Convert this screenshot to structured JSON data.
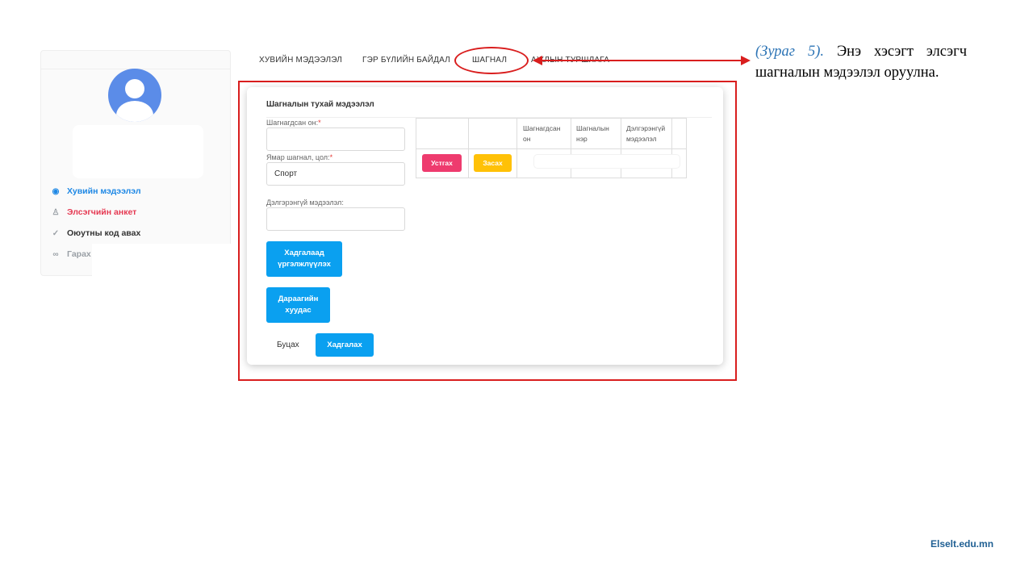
{
  "tabs": {
    "personal": "ХУВИЙН МЭДЭЭЛЭЛ",
    "family": "ГЭР БҮЛИЙН БАЙДАЛ",
    "award": "ШАГНАЛ",
    "experience_partial": "АЖЛЫН ТУРШЛАГА"
  },
  "sidebar": {
    "items": [
      {
        "label": "Хувийн мэдээлэл",
        "color": "#1e88e5"
      },
      {
        "label": "Элсэгчийн анкет",
        "color": "#e53952"
      },
      {
        "label": "Оюутны код авах",
        "color": "#333333"
      },
      {
        "label": "Гарах",
        "color": "#9aa0a6"
      }
    ]
  },
  "annotation": {
    "figure_ref": "(Зураг 5).",
    "text": "Энэ хэсэгт элсэгч шагналын мэдээлэл оруулна."
  },
  "form": {
    "title": "Шагналын тухай мэдээлэл",
    "year_label": "Шагнагдсан он:",
    "award_label": "Ямар шагнал, цол:",
    "award_value": "Спорт",
    "detail_label": "Дэлгэрэнгүй мэдээлэл:",
    "required_mark": "*",
    "save_continue": "Хадгалаад үргэлжлүүлэх",
    "next_page": "Дараагийн хуудас",
    "back": "Буцах",
    "save": "Хадгалах"
  },
  "table": {
    "headers": [
      "Шагнагдсан он",
      "Шагналын нэр",
      "Дэлгэрэнгүй мэдээлэл"
    ],
    "delete_label": "Устгах",
    "edit_label": "Засах"
  },
  "footer": "Elselt.edu.mn",
  "colors": {
    "accent_blue": "#0aa0f0",
    "danger_pink": "#ee3b6e",
    "warning_yellow": "#ffc107",
    "annotation_red": "#d91e1e"
  }
}
